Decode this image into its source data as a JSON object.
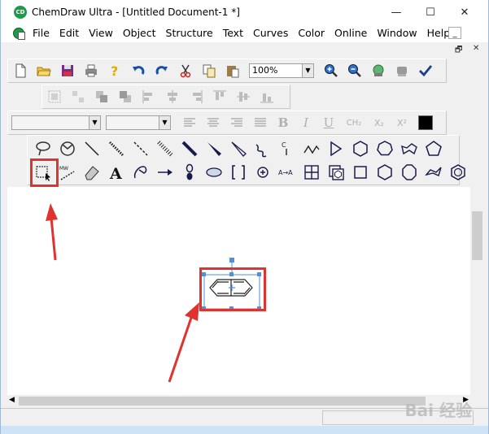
{
  "window": {
    "title": "ChemDraw Ultra - [Untitled Document-1 *]",
    "app_logo_text": "CD"
  },
  "window_controls": {
    "minimize": "—",
    "maximize": "☐",
    "close": "✕"
  },
  "menu": [
    "File",
    "Edit",
    "View",
    "Object",
    "Structure",
    "Text",
    "Curves",
    "Color",
    "Online",
    "Window",
    "Help"
  ],
  "mdi": {
    "minimize": "_",
    "restore": "🗗",
    "close": "✕"
  },
  "toolbar_main": {
    "icons": [
      "new-document-icon",
      "open-folder-icon",
      "save-icon",
      "print-icon",
      "help-icon",
      "undo-icon",
      "redo-icon",
      "cut-icon",
      "copy-icon",
      "paste-icon"
    ],
    "zoom_value": "100%",
    "icons_right": [
      "zoom-in-icon",
      "zoom-out-icon",
      "show-structure-icon",
      "robot-icon",
      "check-icon"
    ]
  },
  "toolbar_arrange": {
    "icons": [
      "group-icon",
      "ungroup-icon",
      "bring-front-icon",
      "send-back-icon",
      "align-left-icon",
      "align-center-h-icon",
      "align-right-icon",
      "align-top-icon",
      "align-middle-icon",
      "align-bottom-icon"
    ]
  },
  "toolbar_format": {
    "font_value": "",
    "size_value": "",
    "buttons": {
      "bold": "B",
      "italic": "I",
      "underline": "U",
      "subscript_ch2": "CH₂",
      "subscript_x2": "X₂",
      "superscript_x2": "X²"
    },
    "color": "#000000"
  },
  "palette": {
    "row1": [
      "lasso-icon",
      "structure-perspective-icon",
      "solid-bond-icon",
      "hashed-bond-icon",
      "dashed-bond-icon",
      "hashed-wedge-bond-icon",
      "bold-bond-icon",
      "wedge-bond-icon",
      "hollow-wedge-bond-icon",
      "wavy-bond-icon",
      "chain-icon",
      "acyclic-chain-icon",
      "triangle-ring-icon",
      "hexagon-ring-icon",
      "heptagon-ring-icon",
      "cyclopentane-icon",
      "pentagon-ring-icon"
    ],
    "row2": [
      "marquee-icon",
      "mass-fragmentation-icon",
      "eraser-icon",
      "text-icon",
      "pen-icon",
      "arrow-icon",
      "orbital-icon",
      "drawing-element-icon",
      "bracket-icon",
      "charge-icon",
      "reaction-mapping-icon",
      "table-icon",
      "templates-icon",
      "square-ring-icon",
      "cyclohexane-icon",
      "octagon-ring-icon",
      "cyclopentane-chair-icon",
      "benzene-icon"
    ]
  },
  "colors": {
    "annotation": "#e0332f",
    "selection": "#4f92d8",
    "accent": "#1f9a4a"
  }
}
